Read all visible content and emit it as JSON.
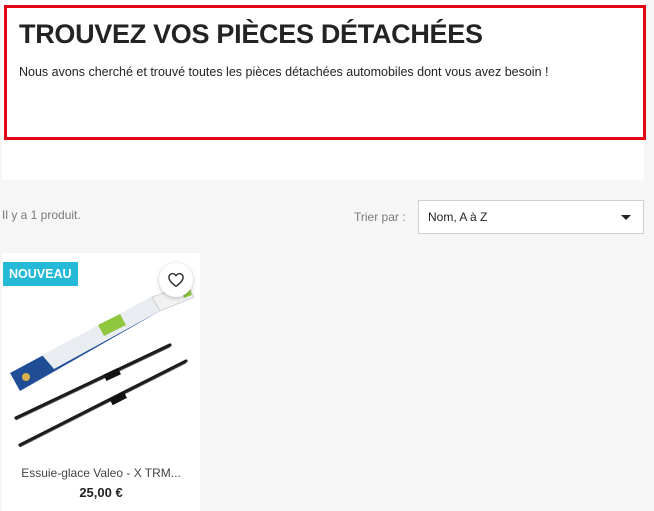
{
  "header": {
    "title": "TROUVEZ VOS PIÈCES DÉTACHÉES",
    "description": "Nous avons cherché et trouvé toutes les pièces détachées automobiles dont vous avez besoin !"
  },
  "listing": {
    "product_count": "Il y a 1 produit.",
    "sort_label": "Trier par :",
    "sort_value": "Nom, A à Z"
  },
  "products": [
    {
      "badge": "NOUVEAU",
      "name": "Essuie-glace Valeo - X TRM...",
      "price": "25,00 €",
      "image_icon": "wiper-blade-icon",
      "wishlist_icon": "heart-icon"
    }
  ],
  "colors": {
    "highlight_border": "#e30613",
    "badge_bg": "#24b9d7",
    "text": "#232323",
    "muted_text": "#7a7a7a"
  }
}
